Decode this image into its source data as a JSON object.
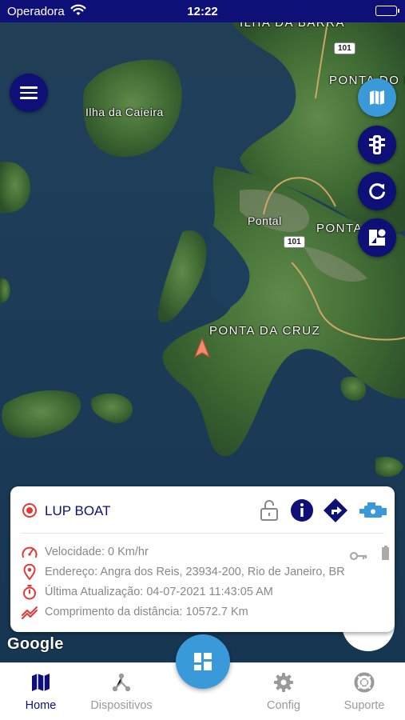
{
  "status_bar": {
    "carrier": "Operadora",
    "time": "12:22"
  },
  "map": {
    "labels": {
      "ilha_da_barra": "ILHA DA BARRA",
      "ponta_do_pa": "PONTA DO PA",
      "ilha_da_caieira": "Ilha da Caieira",
      "pontal": "Pontal",
      "ponta": "PONTA",
      "ponta_da_cruz": "PONTA DA CRUZ"
    },
    "route_shields": [
      "101",
      "101"
    ],
    "attribution": "Google"
  },
  "device_card": {
    "name": "LUP BOAT",
    "status_color": "#e53935",
    "speed": "Velocidade: 0 Km/hr",
    "address": "Endereço: Angra dos Reis, 23934-200, Rio de Janeiro, BR",
    "last_update": "Última Atualização: 04-07-2021 11:43:05 AM",
    "distance": "Comprimento da distância: 10572.7 Km",
    "header_icons": [
      "lock-open-icon",
      "info-icon",
      "directions-icon",
      "engine-icon"
    ]
  },
  "bottom_nav": {
    "items": [
      {
        "label": "Home",
        "icon": "map-icon",
        "active": true
      },
      {
        "label": "Dispositivos",
        "icon": "devices-icon",
        "active": false
      },
      {
        "label": "Config",
        "icon": "gear-icon",
        "active": false
      },
      {
        "label": "Suporte",
        "icon": "support-icon",
        "active": false
      }
    ]
  },
  "colors": {
    "primary": "#0e1077",
    "accent": "#3a9ad9",
    "alert": "#e53935",
    "muted": "#9a9a9a"
  }
}
